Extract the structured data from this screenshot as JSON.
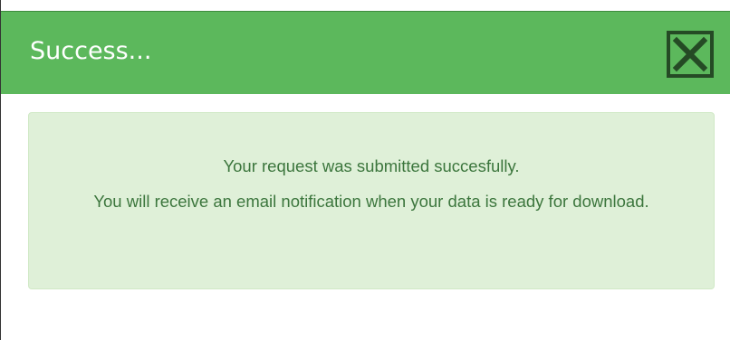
{
  "dialog": {
    "title": "Success...",
    "close_icon": "close-x-icon",
    "message": {
      "line1": "Your request was submitted succesfully.",
      "line2": "You will receive an email notification when your data is ready for download."
    }
  },
  "colors": {
    "header_bg": "#5cb85c",
    "close_border": "#254a25",
    "alert_bg": "#dff0d8",
    "alert_text": "#3c763d"
  }
}
